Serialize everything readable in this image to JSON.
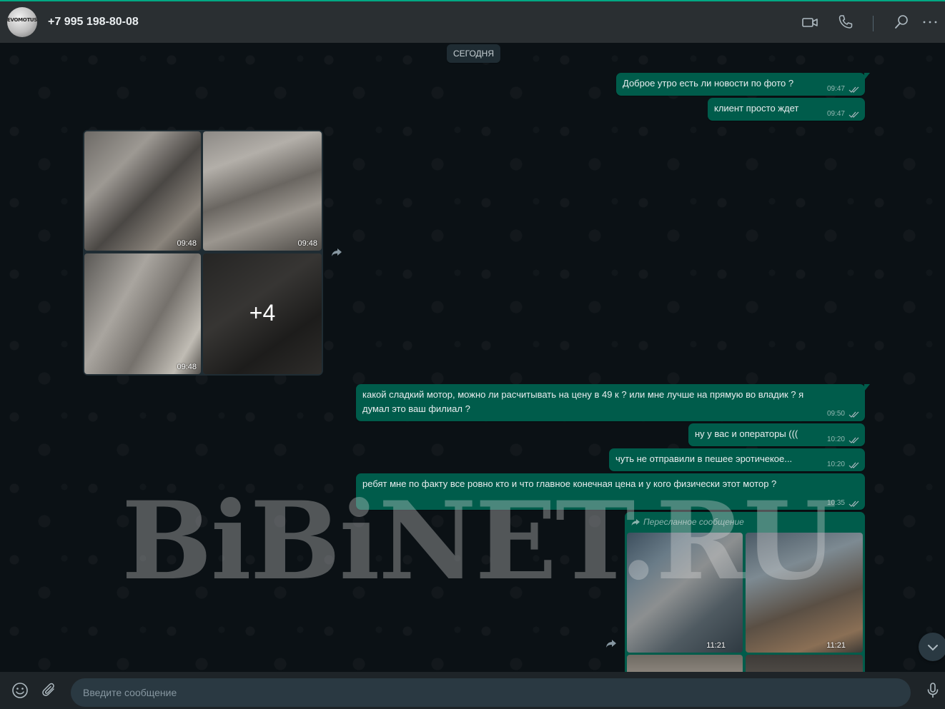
{
  "header": {
    "avatar_text": "EVOMOTUS.RU",
    "contact_name": "+7 995 198-80-08",
    "icons": [
      "video-call-icon",
      "voice-call-icon",
      "search-icon",
      "menu-dots-icon"
    ]
  },
  "chat": {
    "date_label": "СЕГОДНЯ",
    "messages": [
      {
        "text": "Доброе утро есть ли новости по фото ?",
        "time": "09:47"
      },
      {
        "text": "клиент просто ждет",
        "time": "09:47"
      },
      {
        "text": "какой сладкий мотор, можно ли расчитывать на цену в 49 к ? или мне лучше на прямую во владик ? я",
        "text2": "думал это ваш филиал ?",
        "time": "09:50"
      },
      {
        "text": "ну у вас и операторы (((",
        "time": "10:20"
      },
      {
        "text": "чуть не отправили в пешее эротичекое...",
        "time": "10:20"
      },
      {
        "text": "ребят мне по факту все ровно кто и что главное конечная цена и у кого физически этот мотор  ?",
        "time": "10:35"
      }
    ],
    "album": {
      "photo_times": [
        "09:48",
        "09:48",
        "09:48"
      ],
      "more_count": "+4"
    },
    "forwarded": {
      "label": "Пересланное сообщение",
      "photo_times": [
        "11:21",
        "11:21"
      ]
    },
    "watermark": "BiBiNET.RU"
  },
  "footer": {
    "input_placeholder": "Введите сообщение",
    "icons": [
      "emoji-icon",
      "attach-icon",
      "microphone-icon"
    ]
  },
  "colors": {
    "accent": "#00a884",
    "outgoing_bubble": "#005c4b",
    "header_bg": "#2a2f32",
    "chat_bg": "#0b1115"
  }
}
